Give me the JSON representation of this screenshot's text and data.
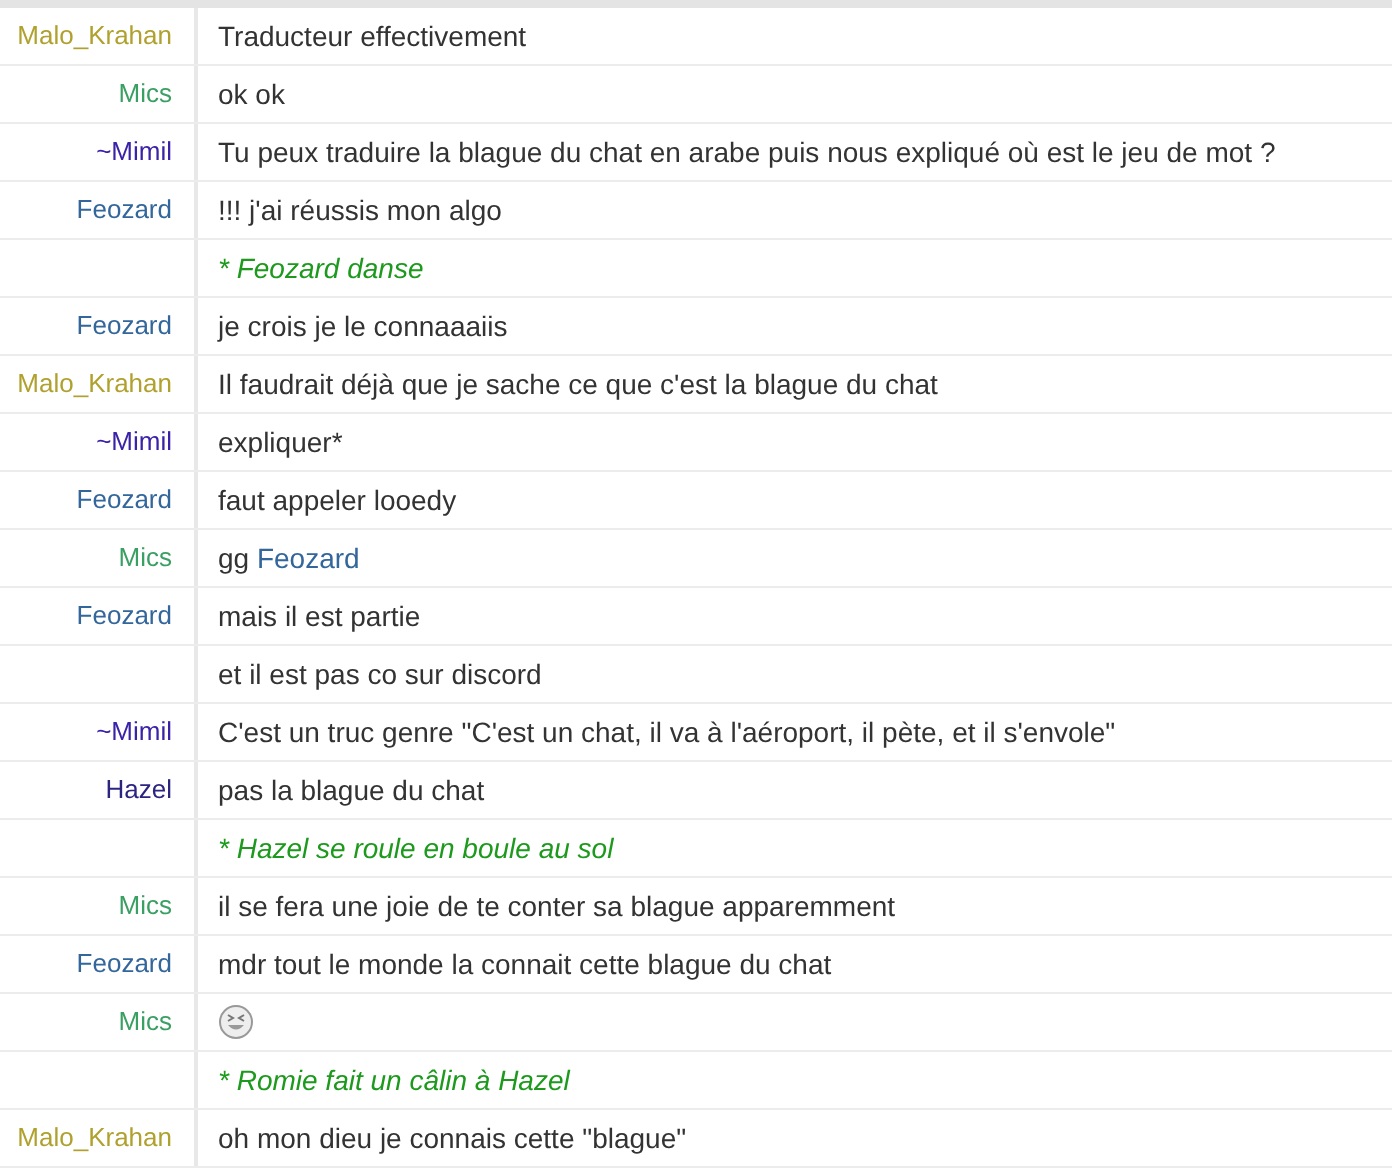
{
  "messages": [
    {
      "kind": "message",
      "nick": "Malo_Krahan",
      "color": "#b0a12e",
      "text": "Traducteur effectivement"
    },
    {
      "kind": "message",
      "nick": "Mics",
      "color": "#3a9f62",
      "text": "ok ok"
    },
    {
      "kind": "message",
      "nick": "~Mimil",
      "color": "#3b22a6",
      "text": "Tu peux traduire la blague du chat en arabe puis nous expliqué où est le jeu de mot ?"
    },
    {
      "kind": "message",
      "nick": "Feozard",
      "color": "#33669b",
      "text": "!!! j'ai réussis mon algo"
    },
    {
      "kind": "action",
      "text": "* Feozard danse"
    },
    {
      "kind": "message",
      "nick": "Feozard",
      "color": "#33669b",
      "text": "je crois je le connaaaiis"
    },
    {
      "kind": "message",
      "nick": "Malo_Krahan",
      "color": "#b0a12e",
      "text": "Il faudrait déjà que je sache ce que c'est la blague du chat"
    },
    {
      "kind": "message",
      "nick": "~Mimil",
      "color": "#3b22a6",
      "text": "expliquer*"
    },
    {
      "kind": "message",
      "nick": "Feozard",
      "color": "#33669b",
      "text": "faut appeler looedy"
    },
    {
      "kind": "message",
      "nick": "Mics",
      "color": "#3a9f62",
      "text": "gg ",
      "mention": "Feozard"
    },
    {
      "kind": "message",
      "nick": "Feozard",
      "color": "#33669b",
      "text": "mais il est partie"
    },
    {
      "kind": "message",
      "text": "et il est pas co sur discord"
    },
    {
      "kind": "message",
      "nick": "~Mimil",
      "color": "#3b22a6",
      "text": "C'est un truc genre \"C'est un chat, il va à l'aéroport, il pète, et il s'envole\""
    },
    {
      "kind": "message",
      "nick": "Hazel",
      "color": "#2b2580",
      "text": "pas la blague du chat"
    },
    {
      "kind": "action",
      "text": "* Hazel se roule en boule au sol"
    },
    {
      "kind": "message",
      "nick": "Mics",
      "color": "#3a9f62",
      "text": "il se fera une joie de te conter sa blague apparemment"
    },
    {
      "kind": "message",
      "nick": "Feozard",
      "color": "#33669b",
      "text": "mdr tout le monde la connait cette blague du chat"
    },
    {
      "kind": "emoji",
      "nick": "Mics",
      "color": "#3a9f62"
    },
    {
      "kind": "action",
      "text": "* Romie fait un câlin à Hazel"
    },
    {
      "kind": "message",
      "nick": "Malo_Krahan",
      "color": "#b0a12e",
      "text": "oh mon dieu je connais cette \"blague\""
    }
  ]
}
